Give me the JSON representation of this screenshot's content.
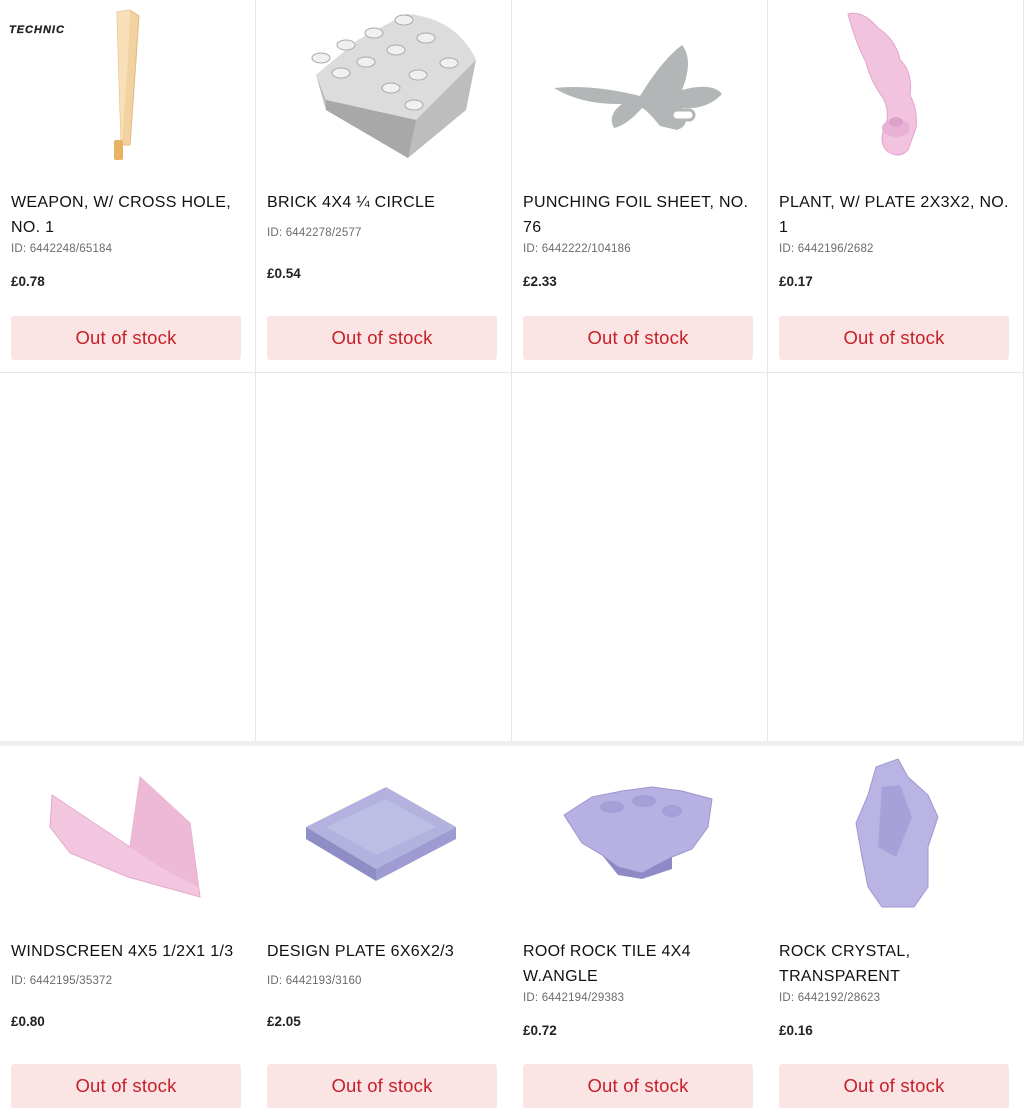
{
  "products": [
    {
      "badge": "TECHNIC",
      "title": "WEAPON, W/ CROSS HOLE, NO. 1",
      "id": "ID: 6442248/65184",
      "price": "£0.78",
      "button": "Out of stock",
      "image_icon": "sword-piece-icon"
    },
    {
      "title": "BRICK 4X4 ¼ CIRCLE",
      "id": "ID: 6442278/2577",
      "price": "£0.54",
      "button": "Out of stock",
      "image_icon": "quarter-circle-brick-icon"
    },
    {
      "title": "PUNCHING FOIL SHEET, NO. 76",
      "id": "ID: 6442222/104186",
      "price": "£2.33",
      "button": "Out of stock",
      "image_icon": "foil-sheet-icon"
    },
    {
      "title": "PLANT, W/ PLATE 2X3X2, NO. 1",
      "id": "ID: 6442196/2682",
      "price": "£0.17",
      "button": "Out of stock",
      "image_icon": "plant-leaf-icon"
    },
    {
      "title": "WINDSCREEN 4X5 1/2X1 1/3",
      "id": "ID: 6442195/35372",
      "price": "£0.80",
      "button": "Out of stock",
      "image_icon": "windscreen-piece-icon"
    },
    {
      "title": "DESIGN PLATE 6X6X2/3",
      "id": "ID: 6442193/3160",
      "price": "£2.05",
      "button": "Out of stock",
      "image_icon": "design-plate-icon"
    },
    {
      "title": "ROOf ROCK TILE 4X4 W.ANGLE",
      "id": "ID: 6442194/29383",
      "price": "£0.72",
      "button": "Out of stock",
      "image_icon": "rock-tile-icon"
    },
    {
      "title": "ROCK CRYSTAL, TRANSPARENT",
      "id": "ID: 6442192/28623",
      "price": "£0.16",
      "button": "Out of stock",
      "image_icon": "rock-crystal-icon"
    }
  ],
  "colors": {
    "button_bg": "#fbe4e4",
    "button_text": "#c8202a",
    "divider": "#e6e6e6"
  }
}
